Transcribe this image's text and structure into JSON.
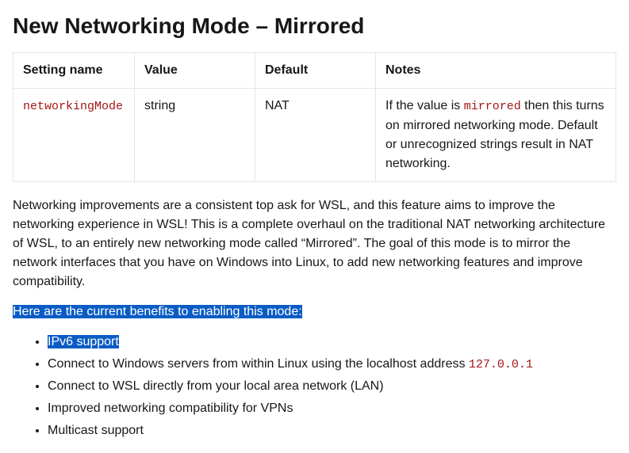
{
  "heading": "New Networking Mode – Mirrored",
  "table": {
    "headers": [
      "Setting name",
      "Value",
      "Default",
      "Notes"
    ],
    "row": {
      "setting_code": "networkingMode",
      "value": "string",
      "default": "NAT",
      "notes_prefix": "If the value is ",
      "notes_code": "mirrored",
      "notes_suffix": " then this turns on mirrored networking mode. Default or unrecognized strings result in NAT networking."
    }
  },
  "paragraph1": "Networking improvements are a consistent top ask for WSL, and this feature aims to improve the networking experience in WSL! This is a complete overhaul on the traditional NAT networking architecture of WSL, to an entirely new networking mode called “Mirrored”. The goal of this mode is to mirror the network interfaces that you have on Windows into Linux, to add new networking features and improve compatibility.",
  "benefits_intro": "Here are the current benefits to enabling this mode:",
  "bullets": {
    "b1": "IPv6 support",
    "b2_prefix": "Connect to Windows servers from within Linux using the localhost address ",
    "b2_code": "127.0.0.1",
    "b3": "Connect to WSL directly from your local area network (LAN)",
    "b4": "Improved networking compatibility for VPNs",
    "b5": "Multicast support"
  }
}
